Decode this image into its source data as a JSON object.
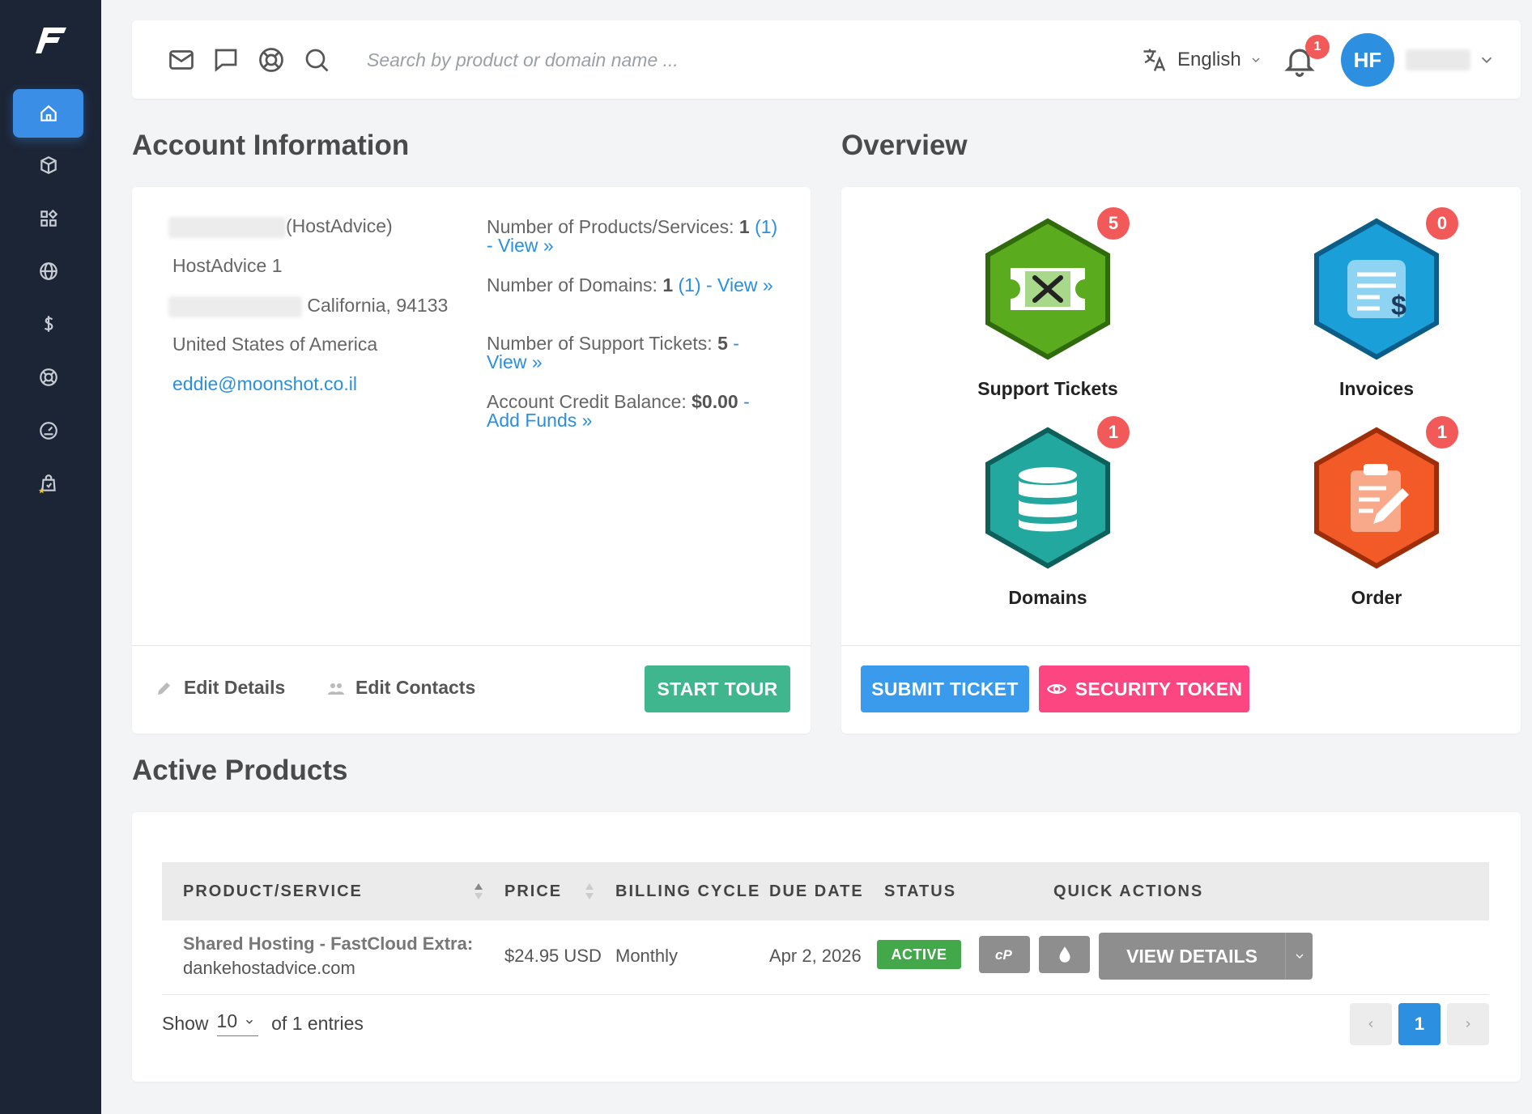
{
  "header": {
    "search_placeholder": "Search by product or domain name ...",
    "language": "English",
    "notifications_count": "1",
    "avatar_initials": "HF"
  },
  "account": {
    "title": "Account Information",
    "company_suffix": "(HostAdvice)",
    "address1": "HostAdvice 1",
    "city_zip": "California, 94133",
    "country": "United States of America",
    "email": "eddie@moonshot.co.il",
    "stats": {
      "products_label": "Number of Products/Services: ",
      "products_value": "1",
      "products_link": "(1) - View »",
      "domains_label": "Number of Domains: ",
      "domains_value": "1",
      "domains_link": "(1) - View »",
      "tickets_label": "Number of Support Tickets: ",
      "tickets_value": "5",
      "tickets_link": "- View »",
      "credit_label": "Account Credit Balance: ",
      "credit_value": "$0.00",
      "credit_link": "- Add Funds »"
    },
    "edit_details": "Edit Details",
    "edit_contacts": "Edit Contacts",
    "start_tour": "START TOUR"
  },
  "overview": {
    "title": "Overview",
    "items": [
      {
        "label": "Support Tickets",
        "count": "5",
        "color": "#5aab1e"
      },
      {
        "label": "Invoices",
        "count": "0",
        "color": "#1a9fd8"
      },
      {
        "label": "Domains",
        "count": "1",
        "color": "#23a8a0"
      },
      {
        "label": "Order",
        "count": "1",
        "color": "#f25a28"
      }
    ],
    "submit_ticket": "SUBMIT TICKET",
    "security_token": "SECURITY TOKEN"
  },
  "products": {
    "title": "Active Products",
    "columns": [
      "PRODUCT/SERVICE",
      "PRICE",
      "BILLING CYCLE",
      "DUE DATE",
      "STATUS",
      "QUICK ACTIONS"
    ],
    "rows": [
      {
        "name": "Shared Hosting - FastCloud Extra:",
        "domain": "dankehostadvice.com",
        "price": "$24.95 USD",
        "cycle": "Monthly",
        "due": "Apr 2, 2026",
        "status": "ACTIVE",
        "view_details": "VIEW DETAILS"
      }
    ],
    "show_label": "Show",
    "show_value": "10",
    "entries_label": "of 1 entries",
    "current_page": "1"
  },
  "colors": {
    "sidebar": "#1c2536",
    "accent": "#3a8ee6",
    "start_tour": "#3fb68d",
    "submit_ticket": "#3a9bec",
    "security_token": "#fb4682",
    "active": "#43a84a",
    "badge": "#f25a5a"
  }
}
